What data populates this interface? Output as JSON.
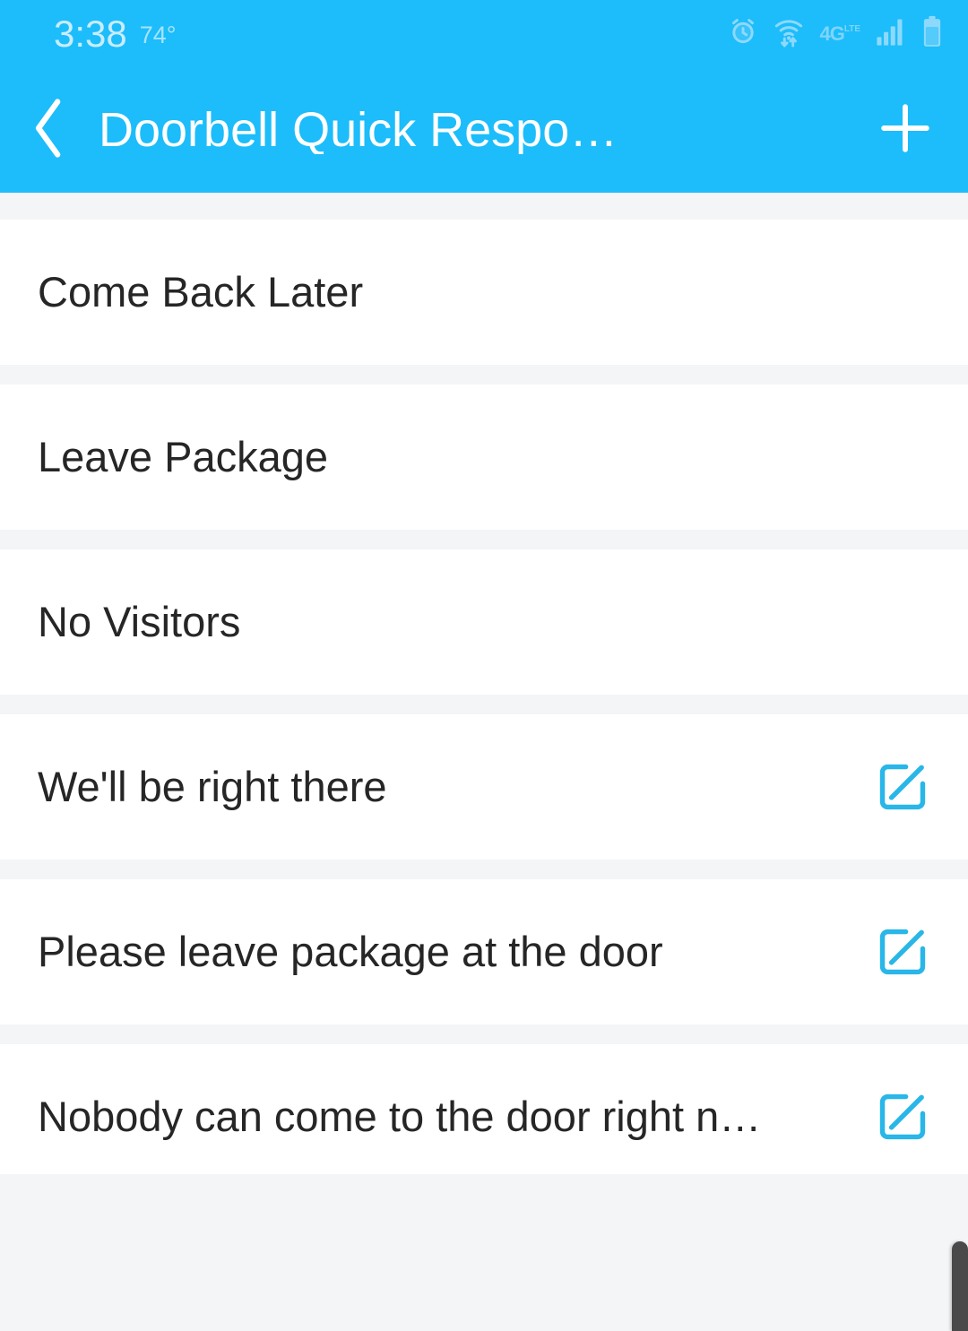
{
  "status_bar": {
    "time": "3:38",
    "temperature": "74°",
    "icons": [
      {
        "name": "alarm-clock-icon"
      },
      {
        "name": "wifi-data-transfer-icon"
      },
      {
        "name": "4g-lte-icon",
        "label": "4G",
        "superscript": "LTE"
      },
      {
        "name": "cellular-signal-icon"
      },
      {
        "name": "battery-icon"
      }
    ],
    "background_color": "#1CBDFA",
    "icon_color": "#8DD9FC"
  },
  "app_bar": {
    "back_label": "back-chevron",
    "title": "Doorbell Quick Respo…",
    "add_label": "add-plus",
    "background_color": "#1CBDFA",
    "text_color": "#FFFFFF"
  },
  "list": {
    "accent_color": "#29B6E8",
    "separator_color": "#F3F5F7",
    "rows": [
      {
        "label": "Come Back Later",
        "editable": false
      },
      {
        "label": "Leave Package",
        "editable": false
      },
      {
        "label": "No Visitors",
        "editable": false
      },
      {
        "label": "We'll be right there",
        "editable": true
      },
      {
        "label": "Please leave package at the door",
        "editable": true
      },
      {
        "label": "Nobody can come to the door right n…",
        "editable": true
      }
    ]
  },
  "scrollbar": {
    "name": "vertical-scrollbar-thumb",
    "color": "#4A4A4A"
  }
}
